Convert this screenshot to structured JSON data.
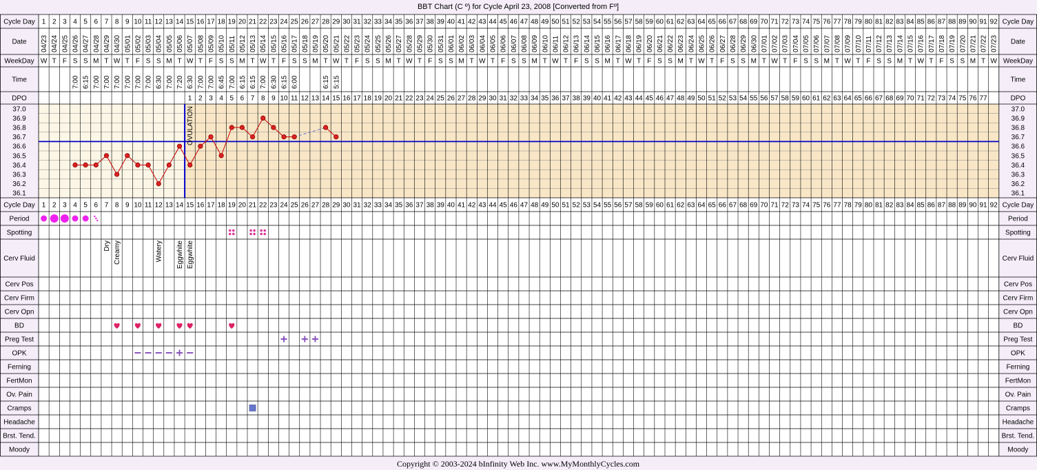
{
  "title": "BBT Chart (C º) for Cycle April 23, 2008  [Converted from Fº]",
  "footer": "Copyright © 2003-2024 bInfinity Web Inc.     www.MyMonthlyCycles.com",
  "colors": {
    "page_bg": "#f5eef9",
    "pre_ovulation_bg": "#fbf6e6",
    "post_ovulation_bg": "#f8e6c6",
    "grid": "#000000",
    "temp_line": "#cc0000",
    "temp_point": "#dd2222",
    "coverline": "#0000cc",
    "ovulation_line": "#0000cc",
    "period": "#ee22ee",
    "spotting": "#dd3399",
    "heart": "#dd2266",
    "test_marks": "#8855bb",
    "cramps": "#6677cc"
  },
  "row_labels": {
    "cycle_day": "Cycle Day",
    "date": "Date",
    "weekday": "WeekDay",
    "time": "Time",
    "dpo": "DPO",
    "period": "Period",
    "spotting": "Spotting",
    "cerv_fluid": "Cerv Fluid",
    "cerv_pos": "Cerv Pos",
    "cerv_firm": "Cerv Firm",
    "cerv_opn": "Cerv Opn",
    "bd": "BD",
    "preg_test": "Preg Test",
    "opk": "OPK",
    "ferning": "Ferning",
    "fertmon": "FertMon",
    "ov_pain": "Ov. Pain",
    "cramps": "Cramps",
    "headache": "Headache",
    "brst_tend": "Brst. Tend.",
    "moody": "Moody"
  },
  "dates": [
    "04/23",
    "04/24",
    "04/25",
    "04/26",
    "04/27",
    "04/28",
    "04/29",
    "04/30",
    "05/01",
    "05/02",
    "05/03",
    "05/04",
    "05/05",
    "05/06",
    "05/07",
    "05/08",
    "05/09",
    "05/10",
    "05/11",
    "05/12",
    "05/13",
    "05/14",
    "05/15",
    "05/16",
    "05/17",
    "05/18",
    "05/19",
    "05/20",
    "05/21",
    "05/22",
    "05/23",
    "05/24",
    "05/25",
    "05/26",
    "05/27",
    "05/28",
    "05/29",
    "05/30",
    "05/31",
    "06/01",
    "06/02",
    "06/03",
    "06/04",
    "06/05",
    "06/06",
    "06/07",
    "06/08",
    "06/09",
    "06/10",
    "06/11",
    "06/12",
    "06/13",
    "06/14",
    "06/15",
    "06/16",
    "06/17",
    "06/18",
    "06/19",
    "06/20",
    "06/21",
    "06/22",
    "06/23",
    "06/24",
    "06/25",
    "06/26",
    "06/27",
    "06/28",
    "06/29",
    "06/30",
    "07/01",
    "07/02",
    "07/03",
    "07/04",
    "07/05",
    "07/06",
    "07/07",
    "07/08",
    "07/09",
    "07/10",
    "07/11",
    "07/12",
    "07/13",
    "07/14",
    "07/15",
    "07/16",
    "07/17",
    "07/18",
    "07/19",
    "07/20",
    "07/21",
    "07/22",
    "07/23"
  ],
  "weekdays": [
    "W",
    "T",
    "F",
    "S",
    "S",
    "M",
    "T",
    "W",
    "T",
    "F",
    "S",
    "S",
    "M",
    "T",
    "W",
    "T",
    "F",
    "S",
    "S",
    "M",
    "T",
    "W",
    "T",
    "F",
    "S",
    "S",
    "M",
    "T",
    "W",
    "T",
    "F",
    "S",
    "S",
    "M",
    "T",
    "W",
    "T",
    "F",
    "S",
    "S",
    "M",
    "T",
    "W",
    "T",
    "F",
    "S",
    "S",
    "M",
    "T",
    "W",
    "T",
    "F",
    "S",
    "S",
    "M",
    "T",
    "W",
    "T",
    "F",
    "S",
    "S",
    "M",
    "T",
    "W",
    "T",
    "F",
    "S",
    "S",
    "M",
    "T",
    "W",
    "T",
    "F",
    "S",
    "S",
    "M",
    "T",
    "W",
    "T",
    "F",
    "S",
    "S",
    "M",
    "T",
    "W",
    "T",
    "F",
    "S",
    "S",
    "M",
    "T",
    "W"
  ],
  "times": [
    "",
    "",
    "",
    "7:00",
    "6:15",
    "7:00",
    "7:00",
    "7:00",
    "7:00",
    "7:00",
    "7:00",
    "6:30",
    "7:00",
    "7:20",
    "6:30",
    "7:00",
    "7:00",
    "6:45",
    "7:00",
    "6:15",
    "6:15",
    "7:00",
    "6:30",
    "6:15",
    "6:00",
    "",
    "",
    "6:15",
    "5:15"
  ],
  "dpo_start_day": 15,
  "dpo_count": 77,
  "chart_data": {
    "type": "line",
    "x_label_rows": [
      "Cycle Day",
      "Date",
      "WeekDay",
      "Time",
      "DPO"
    ],
    "ylim": [
      36.1,
      37.0
    ],
    "yticks": [
      "37.0",
      "36.9",
      "36.8",
      "36.7",
      "36.6",
      "36.5",
      "36.4",
      "36.3",
      "36.2",
      "36.1"
    ],
    "temperatures": [
      null,
      null,
      null,
      36.4,
      36.4,
      36.4,
      36.5,
      36.3,
      36.5,
      36.4,
      36.4,
      36.2,
      36.4,
      36.6,
      36.4,
      36.6,
      36.7,
      36.5,
      36.8,
      36.8,
      36.7,
      36.9,
      36.8,
      36.7,
      36.7,
      null,
      null,
      36.8,
      36.7
    ],
    "coverline": 36.65,
    "ovulation_day": 14,
    "ovulation_label": "OVULATION"
  },
  "observations": {
    "period": {
      "1": "medium",
      "2": "heavy",
      "3": "heavy",
      "4": "medium",
      "5": "medium",
      "6": "spotting"
    },
    "spotting": [
      19,
      21,
      22
    ],
    "cerv_fluid": {
      "7": "Dry",
      "8": "Creamy",
      "12": "Watery",
      "14": "Eggwhite",
      "15": "Eggwhite"
    },
    "bd": [
      8,
      10,
      12,
      14,
      15,
      19
    ],
    "preg_test": {
      "24": "+",
      "26": "+",
      "27": "+"
    },
    "opk": {
      "10": "–",
      "11": "–",
      "12": "–",
      "13": "–",
      "14": "+",
      "15": "–"
    },
    "cramps": [
      21
    ]
  }
}
